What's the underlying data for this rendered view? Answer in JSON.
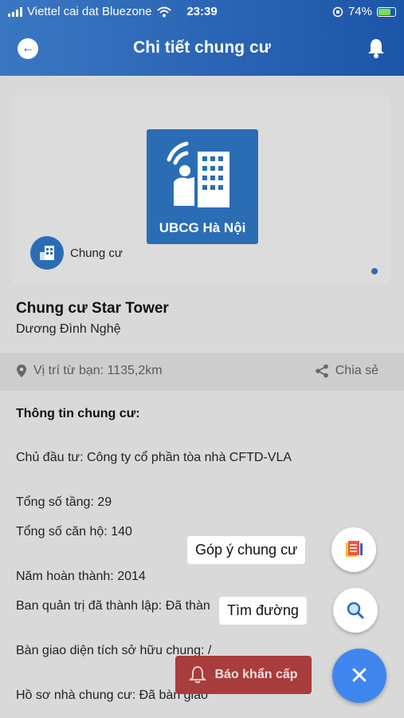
{
  "status_bar": {
    "carrier": "Viettel cai dat Bluezone",
    "time": "23:39",
    "battery": "74%"
  },
  "header": {
    "title": "Chi tiết chung cư"
  },
  "card": {
    "logo_text": "UBCG Hà Nội",
    "category": "Chung cư"
  },
  "building": {
    "name": "Chung cư Star Tower",
    "street": "Dương Đình Nghệ"
  },
  "location_bar": {
    "distance": "Vị trí từ bạn: 1135,2km",
    "share_label": "Chia sẻ"
  },
  "info": {
    "title": "Thông tin chung cư:",
    "lines": [
      "Chủ đầu tư: Công ty cổ phần tòa nhà CFTD-VLA",
      "Tổng số tầng: 29",
      "Tổng số căn hộ: 140",
      "Năm hoàn thành: 2014",
      "Ban quản trị đã thành lập: Đã thàn",
      "Bàn giao diện tích sở hữu chung: /",
      "Hồ sơ nhà chung cư: Đã bàn giao"
    ]
  },
  "fab_menu": {
    "feedback_label": "Góp ý chung cư",
    "directions_label": "Tìm đường",
    "emergency_label": "Báo khẩn cấp"
  },
  "colors": {
    "header": "#2a63b4",
    "accent": "#3f86ef",
    "emergency": "#a93c3c"
  }
}
